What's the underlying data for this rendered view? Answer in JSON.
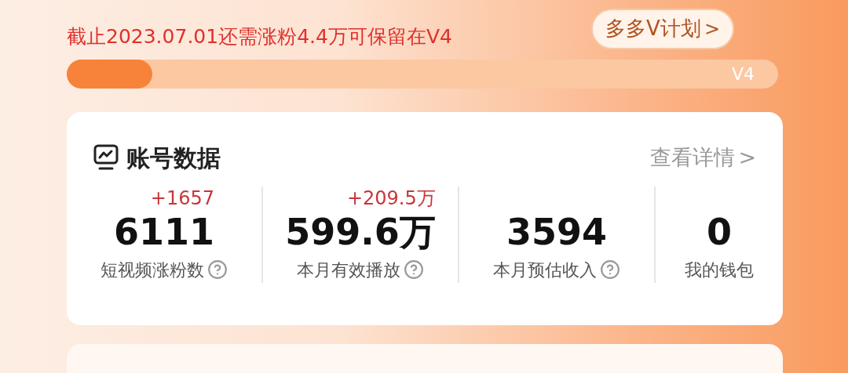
{
  "notice": "截止2023.07.01还需涨粉4.4万可保留在V4",
  "plan_button": {
    "label": "多多V计划",
    "chevron": ">"
  },
  "progress": {
    "level": 0.12,
    "label": "V4"
  },
  "account_card": {
    "title": "账号数据",
    "details_link": "查看详情",
    "details_chevron": ">",
    "stats": [
      {
        "delta": "+1657",
        "value": "6111",
        "label": "短视频涨粉数",
        "help": true
      },
      {
        "delta": "+209.5万",
        "value": "599.6万",
        "label": "本月有效播放",
        "help": true
      },
      {
        "value": "3594",
        "label": "本月预估收入",
        "help": true
      },
      {
        "value": "0",
        "label": "我的钱包",
        "help": false
      }
    ]
  }
}
